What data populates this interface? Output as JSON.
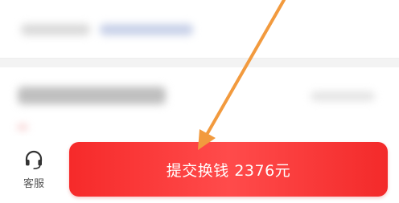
{
  "footer": {
    "service_label": "客服",
    "submit_label": "提交换钱 2376元"
  },
  "colors": {
    "submit_bg": "#f53333",
    "arrow": "#f29a3e",
    "page_bg": "#f3f3f3"
  },
  "icons": {
    "service": "headset-icon",
    "annotation": "annotation-arrow"
  }
}
